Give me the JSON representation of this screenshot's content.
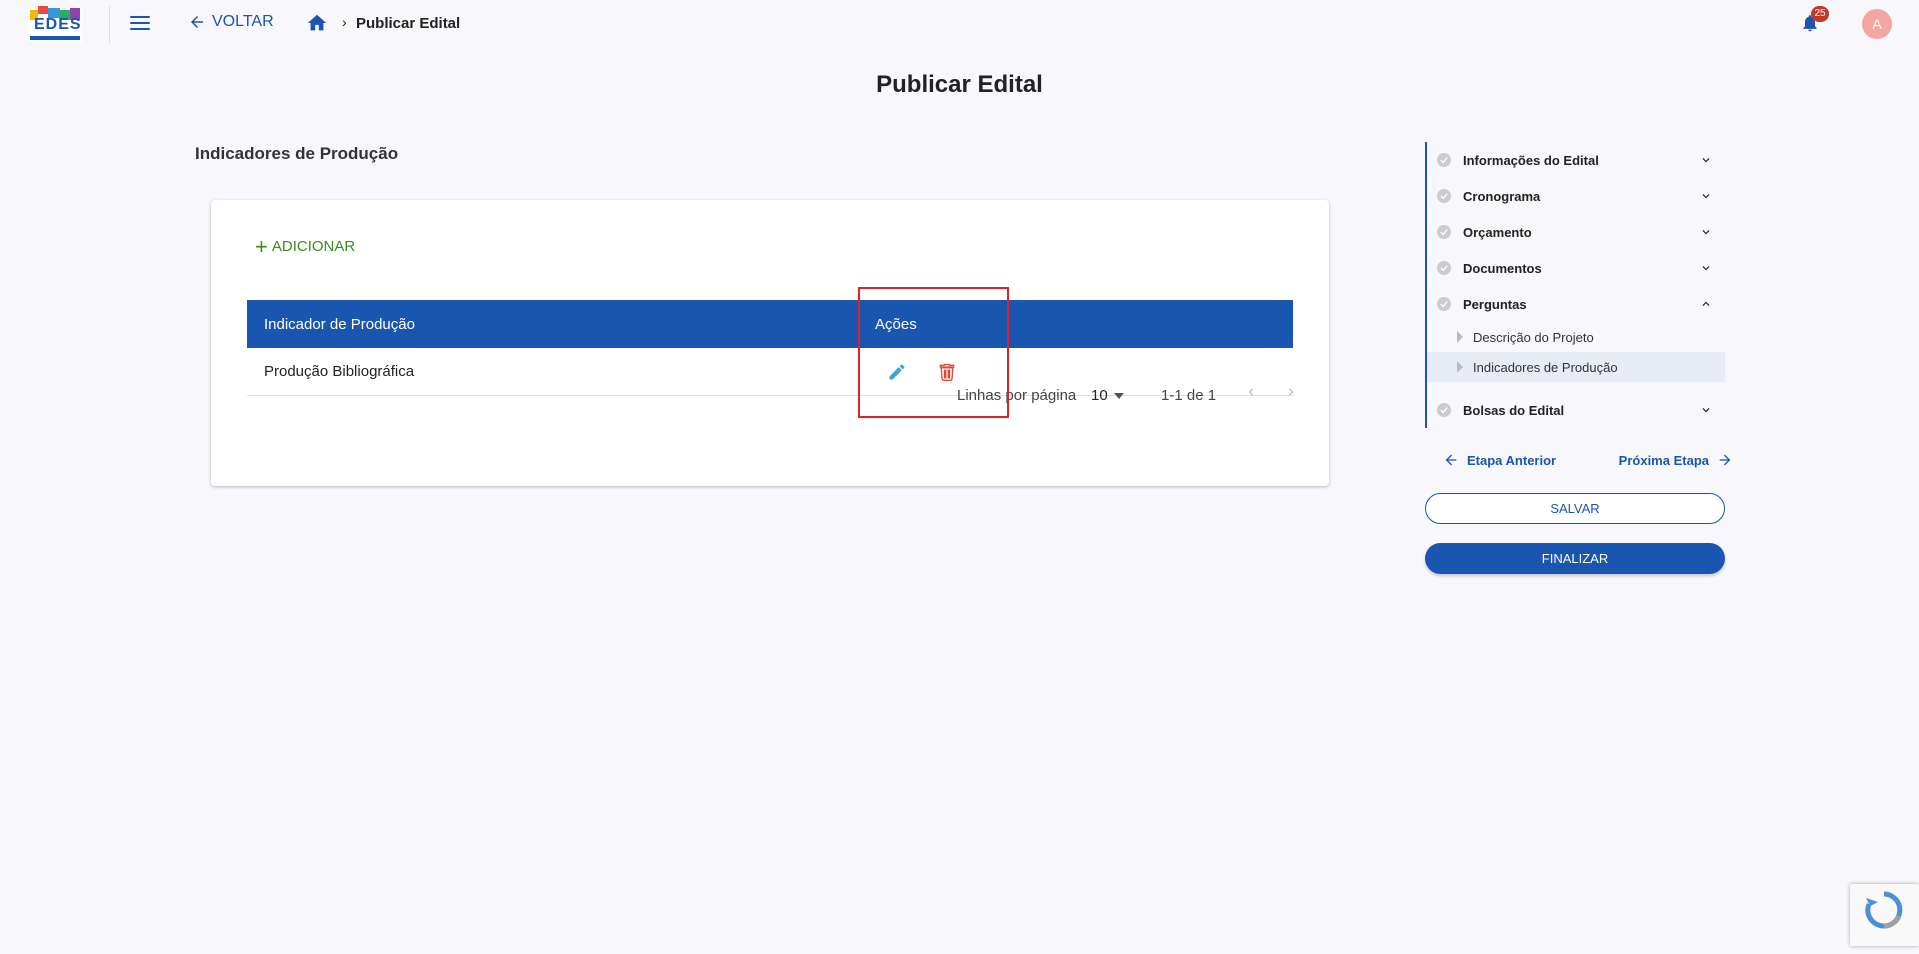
{
  "header": {
    "logo_text": "EDES",
    "back_label": "VOLTAR",
    "breadcrumb_current": "Publicar Edital",
    "notification_count": "25",
    "avatar_initial": "A"
  },
  "page_title": "Publicar Edital",
  "section_title": "Indicadores de Produção",
  "card": {
    "add_label": "ADICIONAR",
    "table": {
      "columns": [
        "Indicador de Produção",
        "Ações"
      ],
      "rows": [
        {
          "indicador": "Produção Bibliográfica"
        }
      ]
    },
    "pagination": {
      "rows_per_page_label": "Linhas por página",
      "rows_per_page_value": "10",
      "range": "1-1 de 1"
    }
  },
  "stepper": {
    "steps": [
      {
        "label": "Informações do Edital",
        "expanded": false
      },
      {
        "label": "Cronograma",
        "expanded": false
      },
      {
        "label": "Orçamento",
        "expanded": false
      },
      {
        "label": "Documentos",
        "expanded": false
      },
      {
        "label": "Perguntas",
        "expanded": true,
        "substeps": [
          "Descrição do Projeto",
          "Indicadores de Produção"
        ]
      },
      {
        "label": "Bolsas do Edital",
        "expanded": false
      }
    ],
    "prev_label": "Etapa Anterior",
    "next_label": "Próxima Etapa",
    "save_label": "SALVAR",
    "finish_label": "FINALIZAR"
  },
  "colors": {
    "primary": "#1a55b0",
    "add": "#3c8a1e",
    "delete": "#e0453a",
    "edit": "#3ba3d6",
    "highlight": "#e0202a"
  }
}
